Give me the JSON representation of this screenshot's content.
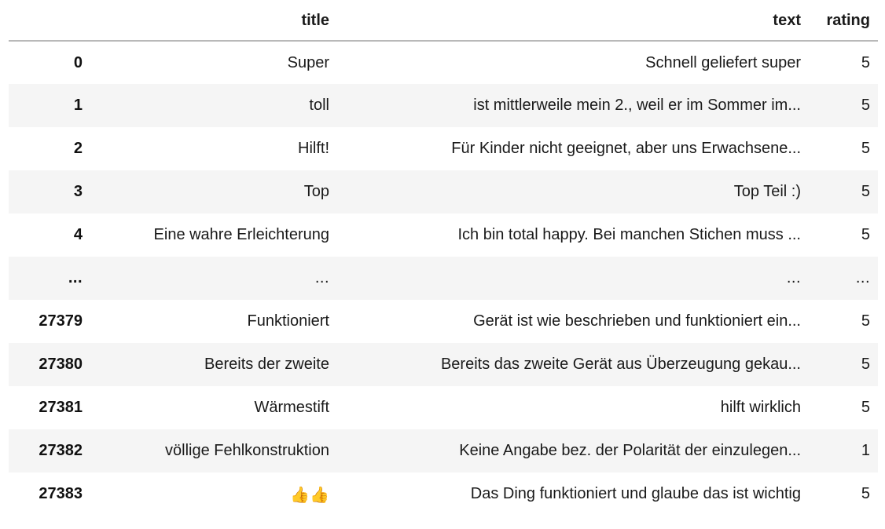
{
  "table": {
    "kind": "pandas-dataframe",
    "columns": [
      {
        "key": "index",
        "label": ""
      },
      {
        "key": "title",
        "label": "title"
      },
      {
        "key": "text",
        "label": "text"
      },
      {
        "key": "rating",
        "label": "rating"
      }
    ],
    "rows": [
      {
        "index": "0",
        "title": "Super",
        "text": "Schnell geliefert super",
        "rating": "5"
      },
      {
        "index": "1",
        "title": "toll",
        "text": "ist mittlerweile mein 2., weil er im Sommer im...",
        "rating": "5"
      },
      {
        "index": "2",
        "title": "Hilft!",
        "text": "Für Kinder nicht geeignet, aber uns Erwachsene...",
        "rating": "5"
      },
      {
        "index": "3",
        "title": "Top",
        "text": "Top Teil :)",
        "rating": "5"
      },
      {
        "index": "4",
        "title": "Eine wahre Erleichterung",
        "text": "Ich bin total happy. Bei manchen Stichen muss ...",
        "rating": "5"
      },
      {
        "index": "...",
        "title": "...",
        "text": "...",
        "rating": "..."
      },
      {
        "index": "27379",
        "title": "Funktioniert",
        "text": "Gerät ist wie beschrieben und funktioniert ein...",
        "rating": "5"
      },
      {
        "index": "27380",
        "title": "Bereits der zweite",
        "text": "Bereits das zweite Gerät aus Überzeugung gekau...",
        "rating": "5"
      },
      {
        "index": "27381",
        "title": "Wärmestift",
        "text": "hilft wirklich",
        "rating": "5"
      },
      {
        "index": "27382",
        "title": "völlige Fehlkonstruktion",
        "text": "Keine Angabe bez. der Polarität der einzulegen...",
        "rating": "1"
      },
      {
        "index": "27383",
        "title": "👍👍",
        "text": "Das Ding funktioniert und glaube das ist wichtig",
        "rating": "5"
      }
    ],
    "colors": {
      "page_background": "#ffffff",
      "row_stripe": "#f5f5f5",
      "header_rule": "#b9b9b9",
      "text": "#1a1a1a"
    }
  }
}
